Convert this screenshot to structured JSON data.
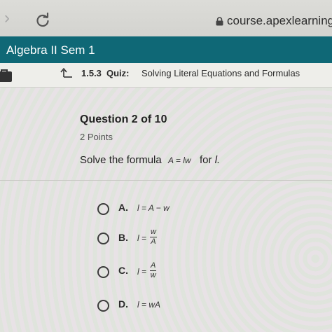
{
  "browser": {
    "url": "course.apexlearning.c"
  },
  "app": {
    "course_title": "Algebra II Sem 1"
  },
  "quiz": {
    "number": "1.5.3",
    "label": "Quiz:",
    "name": "Solving Literal Equations and Formulas"
  },
  "question": {
    "heading": "Question 2 of 10",
    "points": "2 Points",
    "prompt": "Solve the formula",
    "formula": "A = lw",
    "for_text": "for",
    "variable": "l."
  },
  "options": [
    {
      "letter": "A.",
      "lhs": "l =",
      "expr": "A − w"
    },
    {
      "letter": "B.",
      "lhs": "l =",
      "numerator": "w",
      "denominator": "A"
    },
    {
      "letter": "C.",
      "lhs": "l =",
      "numerator": "A",
      "denominator": "w"
    },
    {
      "letter": "D.",
      "lhs": "l =",
      "expr": "wA"
    }
  ],
  "icons": {
    "forward": "chevron-right-icon",
    "reload": "reload-icon",
    "lock": "lock-icon",
    "briefcase": "briefcase-icon",
    "back": "back-arrow-icon"
  },
  "colors": {
    "app_bar": "#0f6876",
    "page_bg": "#ebebe8"
  }
}
